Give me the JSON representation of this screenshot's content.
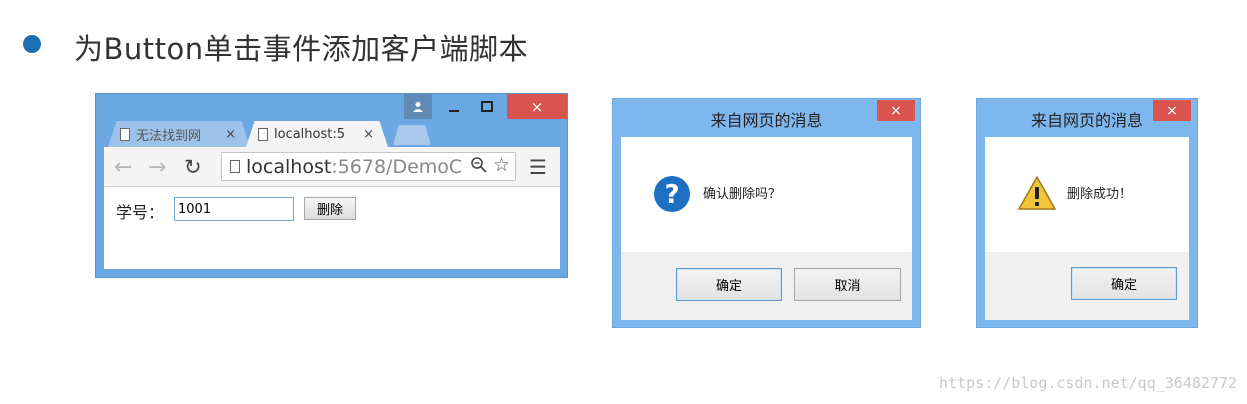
{
  "slide": {
    "heading": "为Button单击事件添加客户端脚本"
  },
  "browser": {
    "tabs": [
      {
        "label": "无法找到网",
        "state": "inactive"
      },
      {
        "label": "localhost:5",
        "state": "active"
      }
    ],
    "tab_close_glyph": "×",
    "window_close_glyph": "×",
    "address": {
      "host": "localhost",
      "path": ":5678/DemoC"
    },
    "page": {
      "field_label": "学号：",
      "input_value": "1001",
      "delete_button": "删除"
    }
  },
  "dialog_confirm": {
    "title": "来自网页的消息",
    "close_glyph": "×",
    "icon": "question-icon",
    "message": "确认删除吗？",
    "ok_label": "确定",
    "cancel_label": "取消"
  },
  "dialog_alert": {
    "title": "来自网页的消息",
    "close_glyph": "×",
    "icon": "warning-icon",
    "message": "删除成功！",
    "ok_label": "确定"
  },
  "watermark": "https://blog.csdn.net/qq_36482772",
  "colors": {
    "titlebar_blue": "#7eb7ee",
    "close_red": "#d9534f",
    "bullet_blue": "#1f6fb5"
  }
}
